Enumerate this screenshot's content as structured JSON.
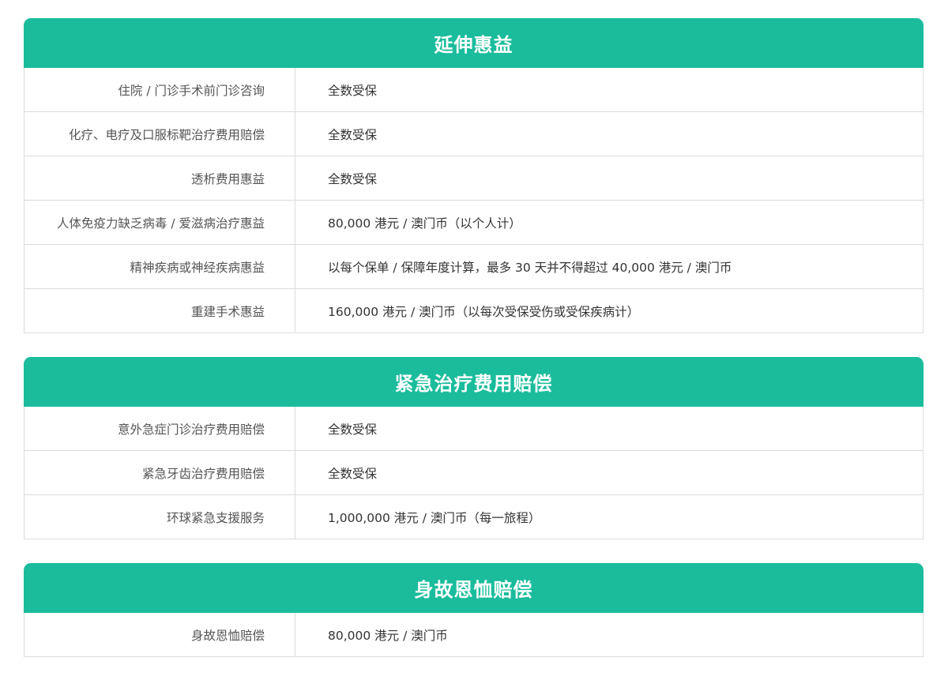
{
  "sections": [
    {
      "title": "延伸惠益",
      "rows": [
        {
          "label": "住院 / 门诊手术前门诊咨询",
          "value": "全数受保"
        },
        {
          "label": "化疗、电疗及口服标靶治疗费用赔偿",
          "value": "全数受保"
        },
        {
          "label": "透析费用惠益",
          "value": "全数受保"
        },
        {
          "label": "人体免疫力缺乏病毒 / 爱滋病治疗惠益",
          "value": "80,000 港元 / 澳门币（以个人计）"
        },
        {
          "label": "精神疾病或神经疾病惠益",
          "value": "以每个保单 / 保障年度计算，最多 30 天并不得超过 40,000 港元 / 澳门币"
        },
        {
          "label": "重建手术惠益",
          "value": "160,000 港元 / 澳门币（以每次受保受伤或受保疾病计）"
        }
      ]
    },
    {
      "title": "紧急治疗费用赔偿",
      "rows": [
        {
          "label": "意外急症门诊治疗费用赔偿",
          "value": "全数受保"
        },
        {
          "label": "紧急牙齿治疗费用赔偿",
          "value": "全数受保"
        },
        {
          "label": "环球紧急支援服务",
          "value": "1,000,000 港元 / 澳门币（每一旅程）"
        }
      ]
    },
    {
      "title": "身故恩恤赔偿",
      "rows": [
        {
          "label": "身故恩恤赔偿",
          "value": "80,000 港元 / 澳门币"
        }
      ]
    }
  ],
  "colors": {
    "header_bg": "#1abc9c",
    "header_text": "#ffffff",
    "border": "#dcdcdc",
    "label_text": "#555555",
    "value_text": "#333333"
  }
}
